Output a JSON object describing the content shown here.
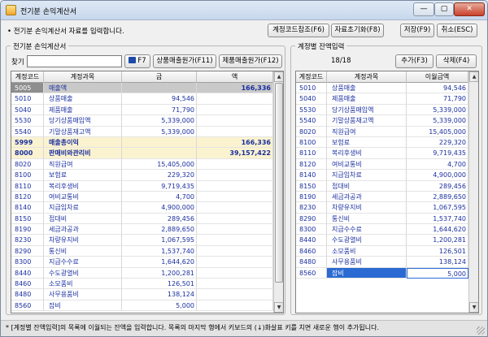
{
  "window": {
    "title": "전기분 손익계산서",
    "min_glyph": "—",
    "max_glyph": "▢",
    "close_glyph": "✕"
  },
  "toolbar": {
    "message": "• 전기분 손익계산서 자료를 입력합니다.",
    "account_code_ref": "계정코드참조(F6)",
    "reset_data": "자료초기화(F8)",
    "save": "저장(F9)",
    "cancel": "취소(ESC)"
  },
  "left_panel": {
    "title": "전기분 손익계산서",
    "search_label": "찾기",
    "search_value": "",
    "f7_label": "F7",
    "product_cogs_button": "상품매출원가(F11)",
    "manufactured_cogs_button": "제품매출원가(F12)",
    "columns": [
      "계정코드",
      "계정과목",
      "금",
      "액"
    ],
    "rows": [
      {
        "code": "5005",
        "name": "매출액",
        "amount": "",
        "total": "166,336",
        "style": "selected"
      },
      {
        "code": "5010",
        "name": "상품매출",
        "amount": "94,546",
        "total": ""
      },
      {
        "code": "5040",
        "name": "제품매출",
        "amount": "71,790",
        "total": ""
      },
      {
        "code": "5530",
        "name": "당기상품매입액",
        "amount": "5,339,000",
        "total": ""
      },
      {
        "code": "5540",
        "name": "기말상품재고액",
        "amount": "5,339,000",
        "total": ""
      },
      {
        "code": "5999",
        "name": "매출총이익",
        "amount": "",
        "total": "166,336",
        "style": "total"
      },
      {
        "code": "8000",
        "name": "판매비와관리비",
        "amount": "",
        "total": "39,157,422",
        "style": "total"
      },
      {
        "code": "8020",
        "name": "직원급여",
        "amount": "15,405,000",
        "total": ""
      },
      {
        "code": "8100",
        "name": "보험료",
        "amount": "229,320",
        "total": ""
      },
      {
        "code": "8110",
        "name": "복리후생비",
        "amount": "9,719,435",
        "total": ""
      },
      {
        "code": "8120",
        "name": "여비교통비",
        "amount": "4,700",
        "total": ""
      },
      {
        "code": "8140",
        "name": "지급임차료",
        "amount": "4,900,000",
        "total": ""
      },
      {
        "code": "8150",
        "name": "접대비",
        "amount": "289,456",
        "total": ""
      },
      {
        "code": "8190",
        "name": "세금과공과",
        "amount": "2,889,650",
        "total": ""
      },
      {
        "code": "8230",
        "name": "차량유지비",
        "amount": "1,067,595",
        "total": ""
      },
      {
        "code": "8290",
        "name": "통신비",
        "amount": "1,537,740",
        "total": ""
      },
      {
        "code": "8300",
        "name": "지급수수료",
        "amount": "1,644,620",
        "total": ""
      },
      {
        "code": "8440",
        "name": "수도광열비",
        "amount": "1,200,281",
        "total": ""
      },
      {
        "code": "8460",
        "name": "소모품비",
        "amount": "126,501",
        "total": ""
      },
      {
        "code": "8480",
        "name": "사무용품비",
        "amount": "138,124",
        "total": ""
      },
      {
        "code": "8560",
        "name": "잡비",
        "amount": "5,000",
        "total": ""
      }
    ]
  },
  "right_panel": {
    "title": "계정별 잔액입력",
    "counter": "18/18",
    "add_button": "추가(F3)",
    "delete_button": "삭제(F4)",
    "columns": [
      "계정코드",
      "계정과목",
      "이월금액"
    ],
    "rows": [
      {
        "code": "5010",
        "name": "상품매출",
        "amount": "94,546"
      },
      {
        "code": "5040",
        "name": "제품매출",
        "amount": "71,790"
      },
      {
        "code": "5530",
        "name": "당기상품매입액",
        "amount": "5,339,000"
      },
      {
        "code": "5540",
        "name": "기말상품재고액",
        "amount": "5,339,000"
      },
      {
        "code": "8020",
        "name": "직원급여",
        "amount": "15,405,000"
      },
      {
        "code": "8100",
        "name": "보험료",
        "amount": "229,320"
      },
      {
        "code": "8110",
        "name": "복리후생비",
        "amount": "9,719,435"
      },
      {
        "code": "8120",
        "name": "여비교통비",
        "amount": "4,700"
      },
      {
        "code": "8140",
        "name": "지급임차료",
        "amount": "4,900,000"
      },
      {
        "code": "8150",
        "name": "접대비",
        "amount": "289,456"
      },
      {
        "code": "8190",
        "name": "세금과공과",
        "amount": "2,889,650"
      },
      {
        "code": "8230",
        "name": "차량유지비",
        "amount": "1,067,595"
      },
      {
        "code": "8290",
        "name": "통신비",
        "amount": "1,537,740"
      },
      {
        "code": "8300",
        "name": "지급수수료",
        "amount": "1,644,620"
      },
      {
        "code": "8440",
        "name": "수도광열비",
        "amount": "1,200,281"
      },
      {
        "code": "8460",
        "name": "소모품비",
        "amount": "126,501"
      },
      {
        "code": "8480",
        "name": "사무용품비",
        "amount": "138,124"
      },
      {
        "code": "8560",
        "name": "잡비",
        "amount": "5,000",
        "style": "cursor"
      }
    ]
  },
  "status": {
    "text": "* [계정별 잔액입력]의 목록에 이월되는 잔액을 입력합니다.  목록의 마지막 행에서 키보드의 (↓)화살표 키를 치면 새로운 행이 추가됩니다."
  },
  "colors": {
    "code_text": "#1a2fa0",
    "total_row_bg": "#fbf3cf",
    "selection_blue": "#2b6ad2"
  }
}
